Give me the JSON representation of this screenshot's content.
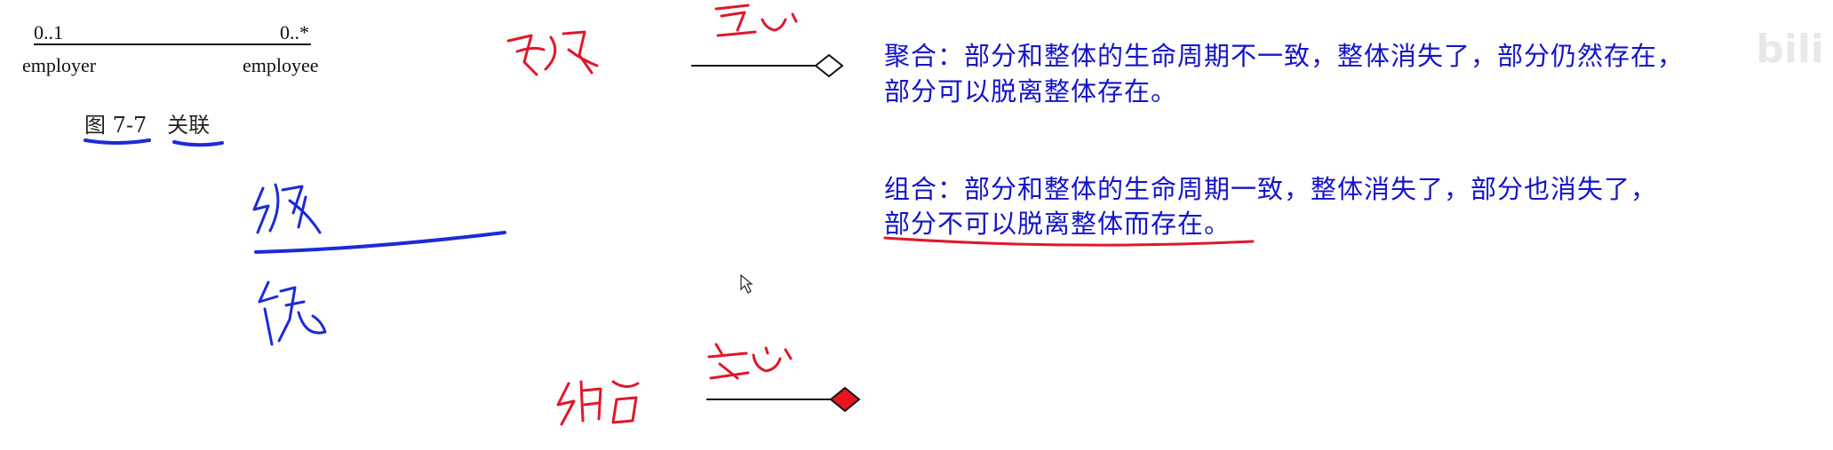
{
  "association_figure": {
    "left_multiplicity": "0..1",
    "right_multiplicity": "0..*",
    "left_role": "employer",
    "right_role": "employee",
    "caption": "图 7-7   关联"
  },
  "aggregation": {
    "definition_line1": "聚合：部分和整体的生命周期不一致，整体消失了，部分仍然存在，",
    "definition_line2": "部分可以脱离整体存在。",
    "diamond_fill": "#ffffff"
  },
  "composition": {
    "definition_line1": "组合：部分和整体的生命周期一致，整体消失了，部分也消失了，",
    "definition_line2": "部分不可以脱离整体而存在。",
    "diamond_fill": "#e8141e"
  },
  "colors": {
    "definition_text": "#1414c8",
    "red_ink": "#e0182a",
    "blue_ink": "#1c2bd6"
  }
}
